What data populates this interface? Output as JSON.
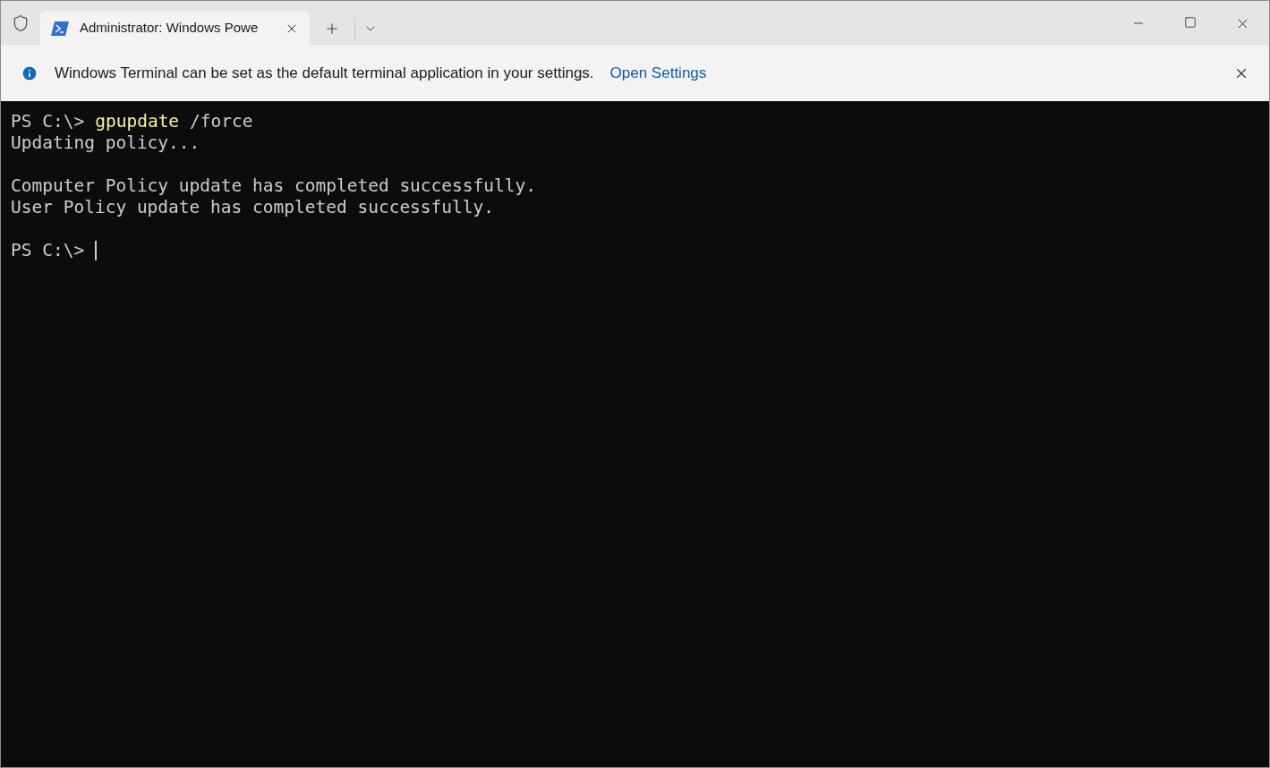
{
  "tabs": [
    {
      "title": "Administrator: Windows Powe",
      "selected": true
    }
  ],
  "infobar": {
    "message": "Windows Terminal can be set as the default terminal application in your settings.",
    "link": "Open Settings"
  },
  "terminal": {
    "lines": [
      {
        "kind": "command",
        "prompt": "PS C:\\>",
        "command": "gpupdate",
        "args": "/force"
      },
      {
        "kind": "output",
        "text": "Updating policy..."
      },
      {
        "kind": "blank"
      },
      {
        "kind": "output",
        "text": "Computer Policy update has completed successfully."
      },
      {
        "kind": "output",
        "text": "User Policy update has completed successfully."
      },
      {
        "kind": "blank"
      },
      {
        "kind": "prompt",
        "prompt": "PS C:\\>",
        "cursor": true
      }
    ]
  }
}
